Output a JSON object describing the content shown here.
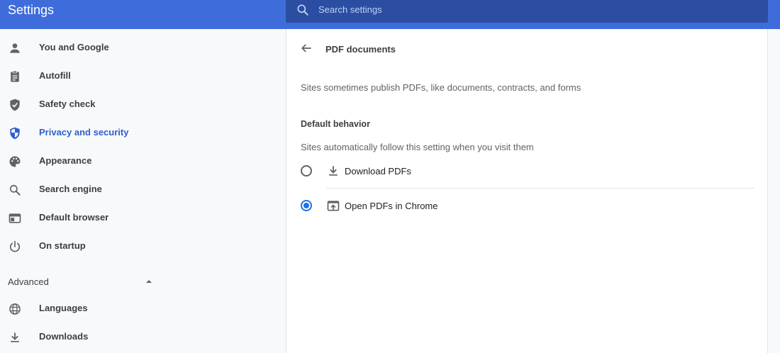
{
  "app": {
    "title": "Settings"
  },
  "search": {
    "placeholder": "Search settings",
    "value": ""
  },
  "sidebar": {
    "items": [
      {
        "label": "You and Google",
        "icon": "person-icon"
      },
      {
        "label": "Autofill",
        "icon": "clipboard-icon"
      },
      {
        "label": "Safety check",
        "icon": "shield-check-icon"
      },
      {
        "label": "Privacy and security",
        "icon": "shield-half-icon",
        "active": true
      },
      {
        "label": "Appearance",
        "icon": "palette-icon"
      },
      {
        "label": "Search engine",
        "icon": "search-icon"
      },
      {
        "label": "Default browser",
        "icon": "browser-window-icon"
      },
      {
        "label": "On startup",
        "icon": "power-icon"
      }
    ],
    "advanced": {
      "label": "Advanced",
      "expanded": true,
      "items": [
        {
          "label": "Languages",
          "icon": "globe-icon"
        },
        {
          "label": "Downloads",
          "icon": "download-icon"
        }
      ]
    }
  },
  "main": {
    "title": "PDF documents",
    "description": "Sites sometimes publish PDFs, like documents, contracts, and forms",
    "section_title": "Default behavior",
    "section_subtext": "Sites automatically follow this setting when you visit them",
    "options": [
      {
        "label": "Download PDFs",
        "icon": "download-icon",
        "selected": false
      },
      {
        "label": "Open PDFs in Chrome",
        "icon": "open-in-browser-icon",
        "selected": true
      }
    ]
  },
  "colors": {
    "header": "#3e6ddb",
    "search_bar": "#2b4ea3",
    "accent": "#1a73e8",
    "active_nav": "#2f5ecf"
  }
}
